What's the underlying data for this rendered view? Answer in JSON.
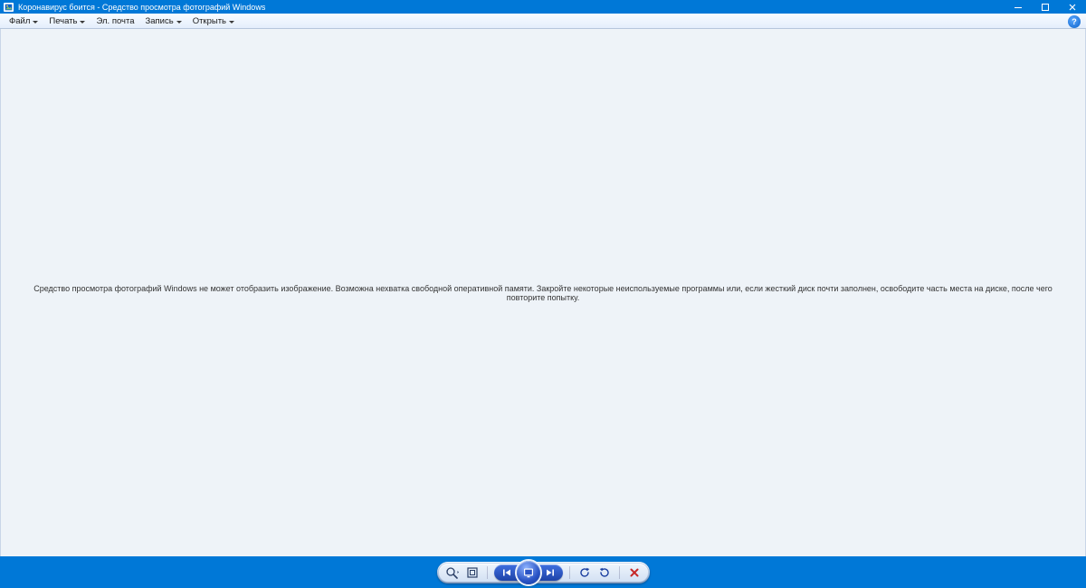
{
  "window": {
    "title": "Коронавирус боится - Средство просмотра фотографий Windows"
  },
  "menu": {
    "file": "Файл",
    "print": "Печать",
    "email": "Эл. почта",
    "burn": "Запись",
    "open": "Открыть",
    "help_glyph": "?"
  },
  "error": {
    "message": "Средство просмотра фотографий Windows не может отобразить изображение. Возможна нехватка свободной оперативной памяти. Закройте некоторые неиспользуемые программы или, если жесткий диск почти заполнен, освободите часть места на диске, после чего повторите попытку."
  },
  "toolbar": {
    "zoom_label": "zoom",
    "fit_label": "fit",
    "prev_label": "previous",
    "slideshow_label": "slideshow",
    "next_label": "next",
    "rotate_ccw_label": "rotate-ccw",
    "rotate_cw_label": "rotate-cw",
    "delete_label": "delete"
  },
  "colors": {
    "accent": "#0078d7",
    "canvas": "#eef3f8"
  }
}
